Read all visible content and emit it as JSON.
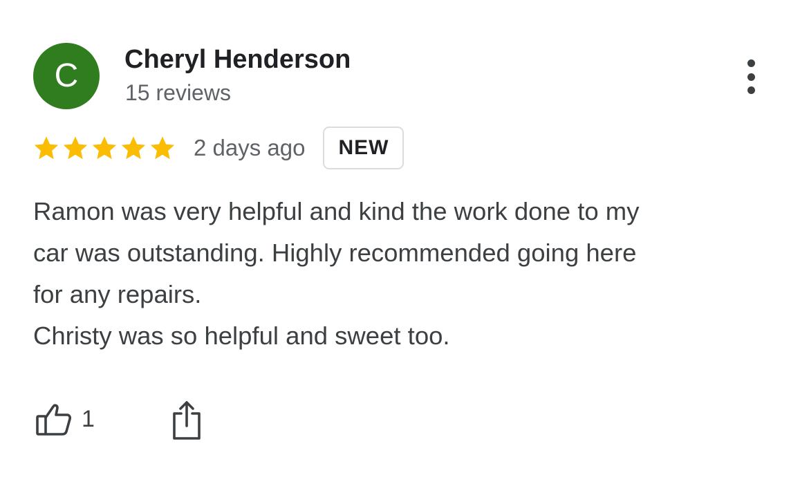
{
  "colors": {
    "avatar_bg": "#2f7d1f",
    "star": "#fbbc04",
    "text_primary": "#202124",
    "text_secondary": "#5f6368",
    "body_text": "#3c4043",
    "badge_border": "#dadce0"
  },
  "review": {
    "author": {
      "initial": "C",
      "name": "Cheryl Henderson",
      "review_count": "15 reviews"
    },
    "rating": 5,
    "rating_max": 5,
    "date": "2 days ago",
    "badge": "NEW",
    "text_lines": [
      "Ramon was very helpful and kind the work done to my",
      "car was outstanding. Highly recommended going here",
      "for any repairs.",
      "Christy was so helpful and sweet too."
    ],
    "likes": "1"
  },
  "icons": {
    "more": "more-vert-icon",
    "star": "star-icon",
    "like": "thumb-up-icon",
    "share": "share-icon"
  }
}
